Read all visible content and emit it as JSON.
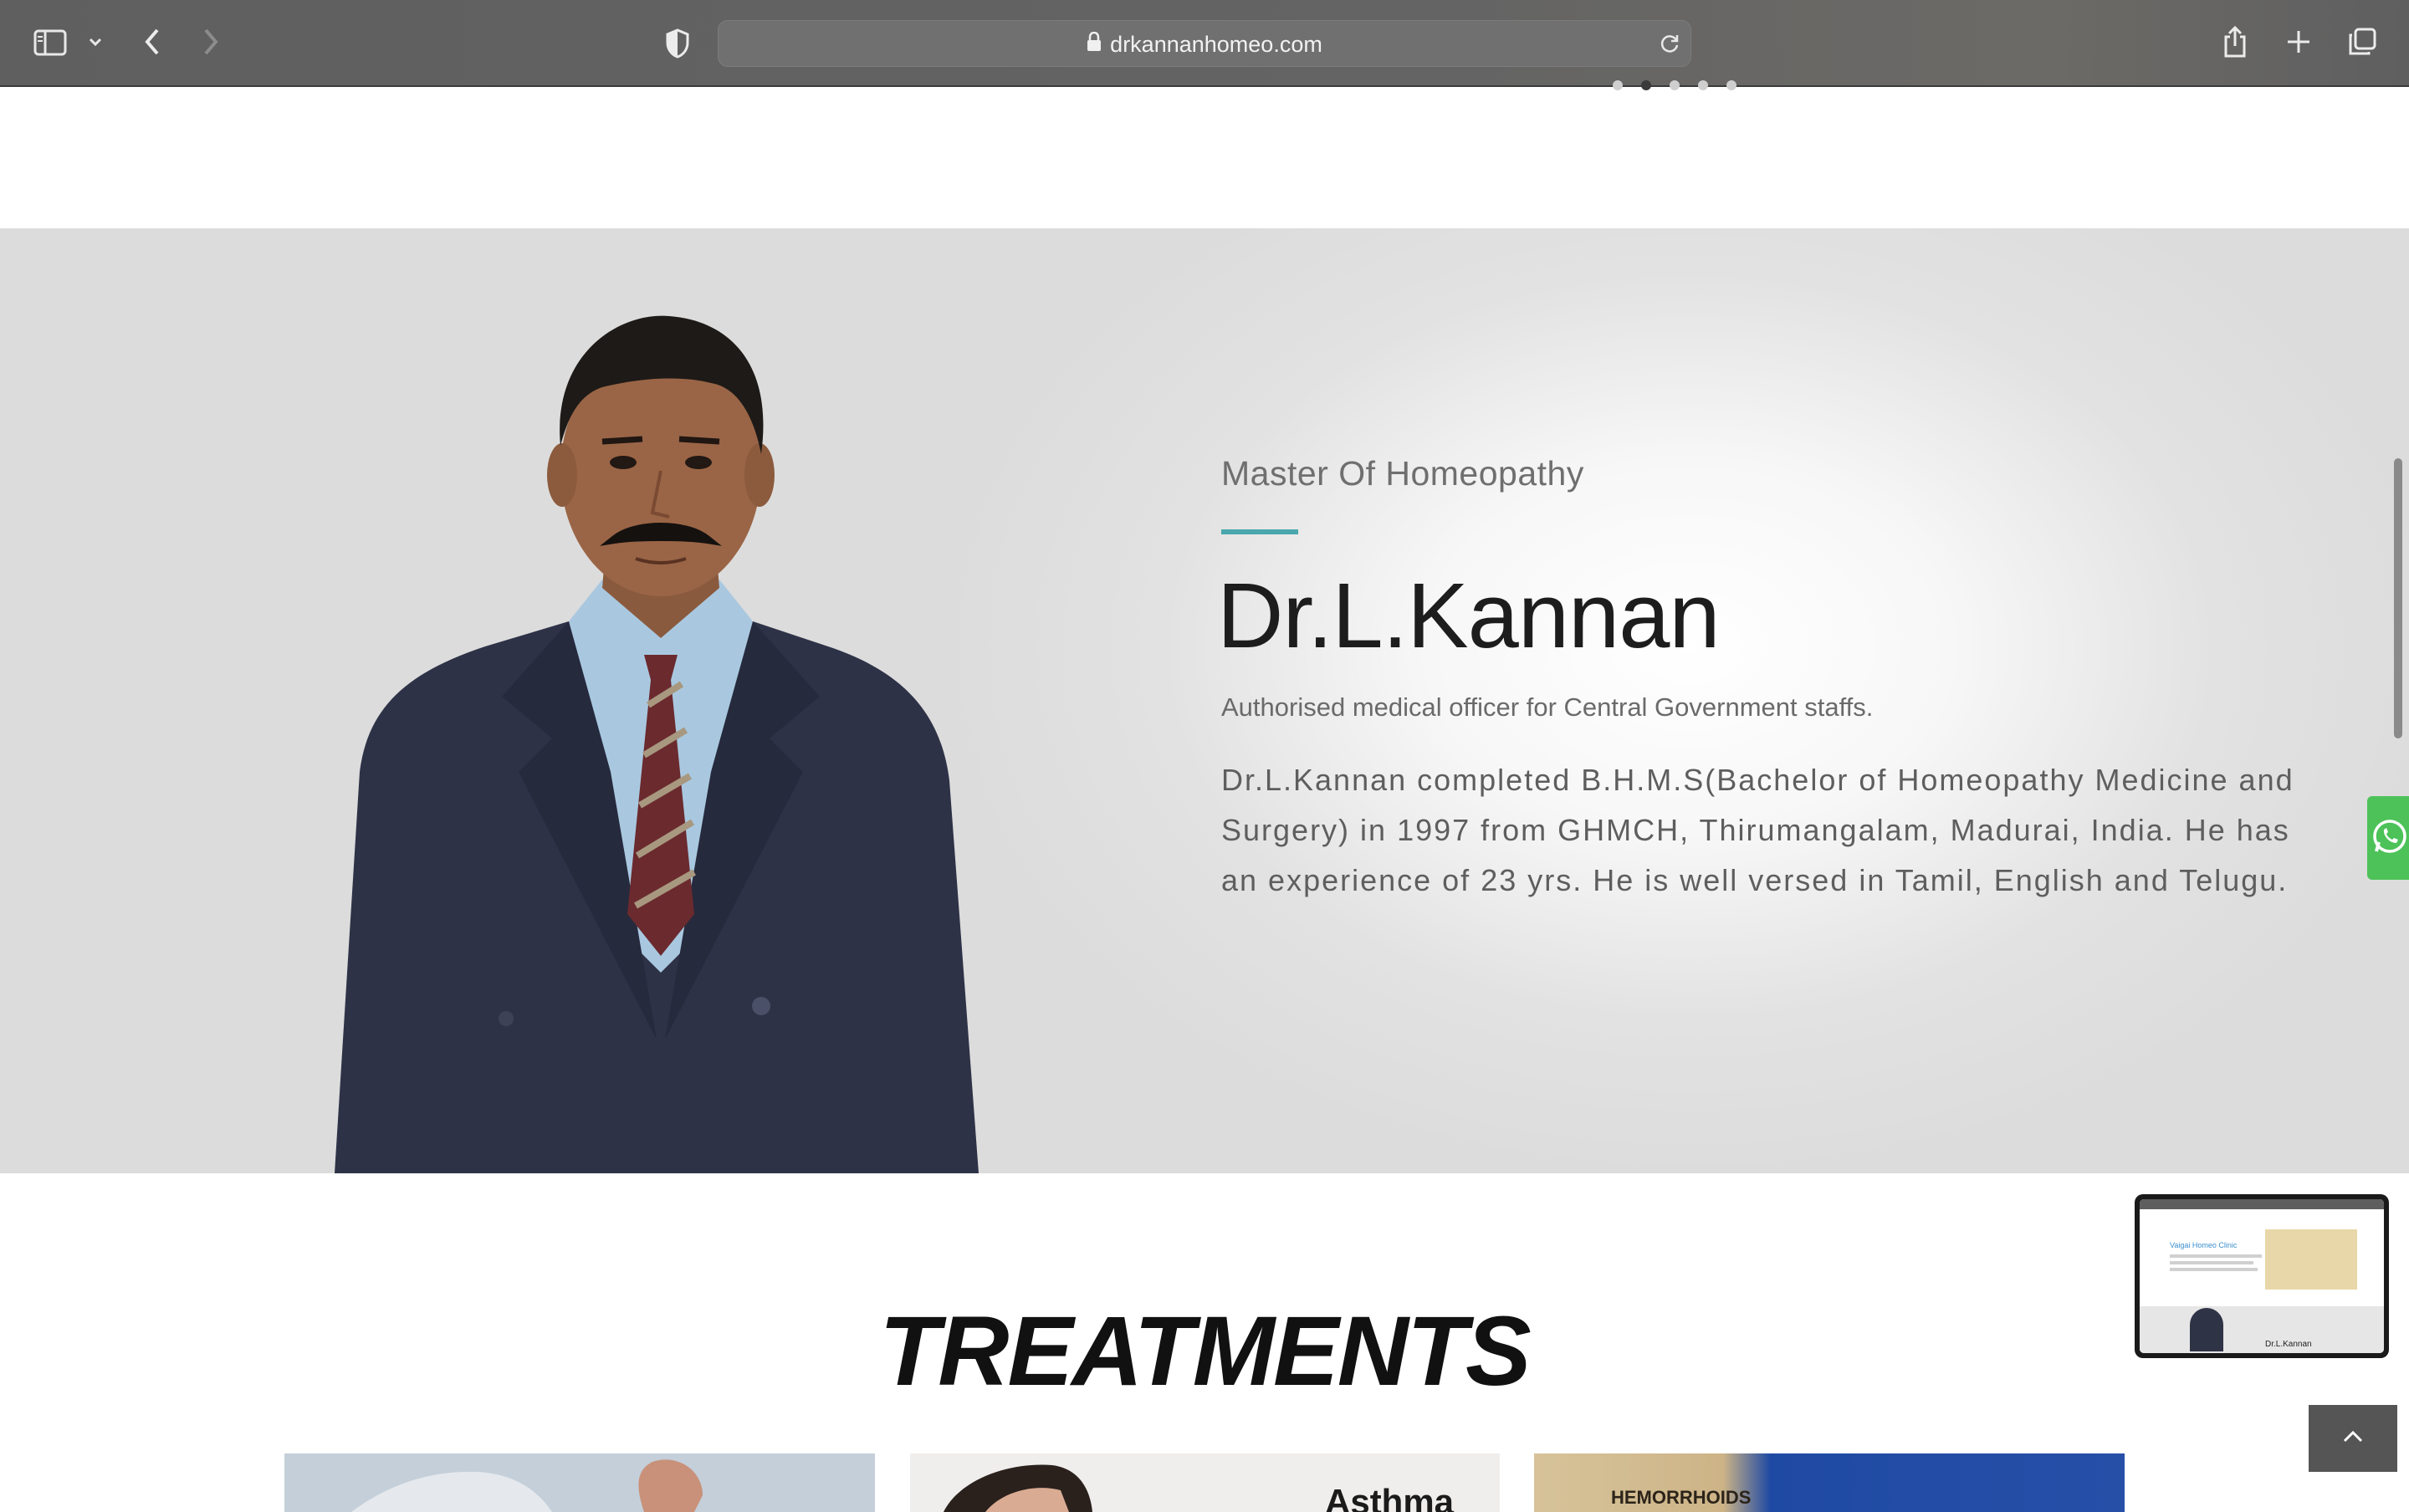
{
  "browser": {
    "url": "drkannanhomeo.com"
  },
  "slider": {
    "dot_count": 5,
    "active_index": 1
  },
  "hero": {
    "subtitle": "Master Of Homeopathy",
    "name": "Dr.L.Kannan",
    "role": "Authorised medical officer for Central Government staffs.",
    "bio": "Dr.L.Kannan completed B.H.M.S(Bachelor of Homeopathy Medicine and Surgery) in 1997  from GHMCH, Thirumangalam, Madurai, India. He has an experience of 23 yrs. He is well versed in Tamil, English and Telugu.",
    "accent_color": "#4aa7ad"
  },
  "treatments": {
    "title": "TREATMENTS",
    "cards": [
      {
        "label": ""
      },
      {
        "label": "Asthma"
      },
      {
        "label": "HEMORRHOIDS"
      }
    ]
  },
  "preview": {
    "clinic_name": "Vaigai Homeo Clinic",
    "doctor_name": "Dr.L.Kannan"
  },
  "colors": {
    "whatsapp": "#4cc259",
    "toolbar": "#636363"
  }
}
